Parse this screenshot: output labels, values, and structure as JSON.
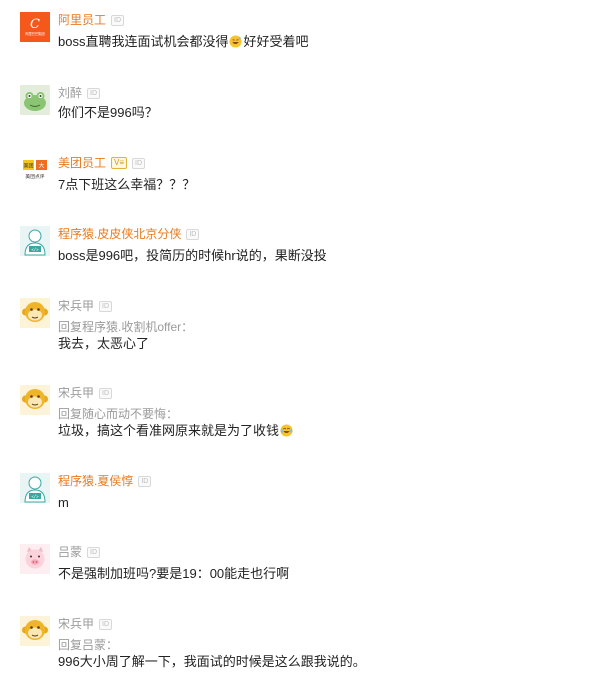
{
  "comments": [
    {
      "username": "阿里员工",
      "badge": "ID",
      "avatar": "alibaba-logo",
      "avatar_label": "阿里巴巴集团",
      "text_before": "boss直聘我连面试机会都没得",
      "emoji": "grinning-sweat-emoji",
      "text_after": "好好受着吧"
    },
    {
      "username": "刘醉",
      "badge": "ID",
      "avatar": "frog-icon",
      "text": "你们不是996吗？"
    },
    {
      "username": "美团员工",
      "vbadge": "V≡",
      "badge": "ID",
      "avatar": "meituan-logo",
      "avatar_label": "美团点评",
      "text": "7点下班这么幸福？？？"
    },
    {
      "username": "程序猿.皮皮侠北京分侠",
      "badge": "ID",
      "avatar": "coder-avatar-icon",
      "text": "boss是996吧，投简历的时候hr说的，果断没投"
    },
    {
      "username": "宋兵甲",
      "badge": "ID",
      "avatar": "monkey-icon",
      "reply_to": "回复程序猿.收割机offer：",
      "text": "我去，太恶心了"
    },
    {
      "username": "宋兵甲",
      "badge": "ID",
      "avatar": "monkey-icon",
      "reply_to": "回复随心而动不要悔：",
      "text_before": "垃圾，搞这个看准网原来就是为了收钱",
      "emoji": "laughing-tears-emoji",
      "text_after": ""
    },
    {
      "username": "程序猿.夏侯惇",
      "badge": "ID",
      "avatar": "coder-avatar-icon",
      "text": "m"
    },
    {
      "username": "吕蒙",
      "badge": "ID",
      "avatar": "pig-icon",
      "text": "不是强制加班吗?要是19：00能走也行啊"
    },
    {
      "username": "宋兵甲",
      "badge": "ID",
      "avatar": "monkey-icon",
      "reply_to": "回复吕蒙：",
      "text": "996大小周了解一下，我面试的时候是这么跟我说的。"
    }
  ],
  "colors": {
    "username_highlight": "#e87b1f",
    "username_normal": "#9b9b9b",
    "text": "#222222",
    "reply": "#9b9b9b"
  }
}
